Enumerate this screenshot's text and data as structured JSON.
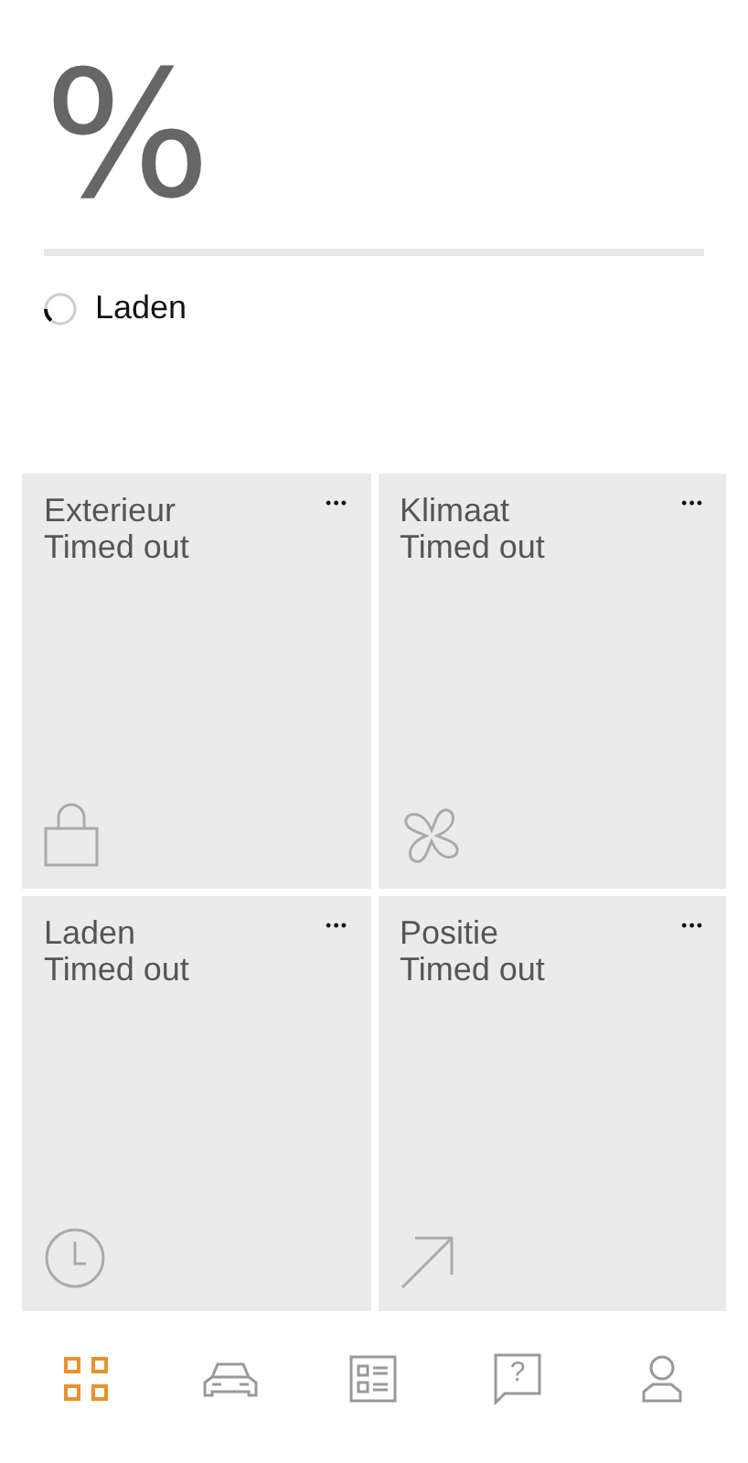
{
  "charge": {
    "percent": "%",
    "status": "Laden"
  },
  "tiles": [
    {
      "title": "Exterieur",
      "status": "Timed out",
      "menu": "•••",
      "kind": "lock"
    },
    {
      "title": "Klimaat",
      "status": "Timed out",
      "menu": "•••",
      "kind": "fan"
    },
    {
      "title": "Laden",
      "status": "Timed out",
      "menu": "•••",
      "kind": "clock"
    },
    {
      "title": "Positie",
      "status": "Timed out",
      "menu": "•••",
      "kind": "arrow"
    }
  ],
  "nav": [
    {
      "kind": "grid",
      "selected": true
    },
    {
      "kind": "car",
      "selected": false
    },
    {
      "kind": "list",
      "selected": false
    },
    {
      "kind": "help",
      "selected": false,
      "glyph": "?"
    },
    {
      "kind": "profile",
      "selected": false
    }
  ]
}
